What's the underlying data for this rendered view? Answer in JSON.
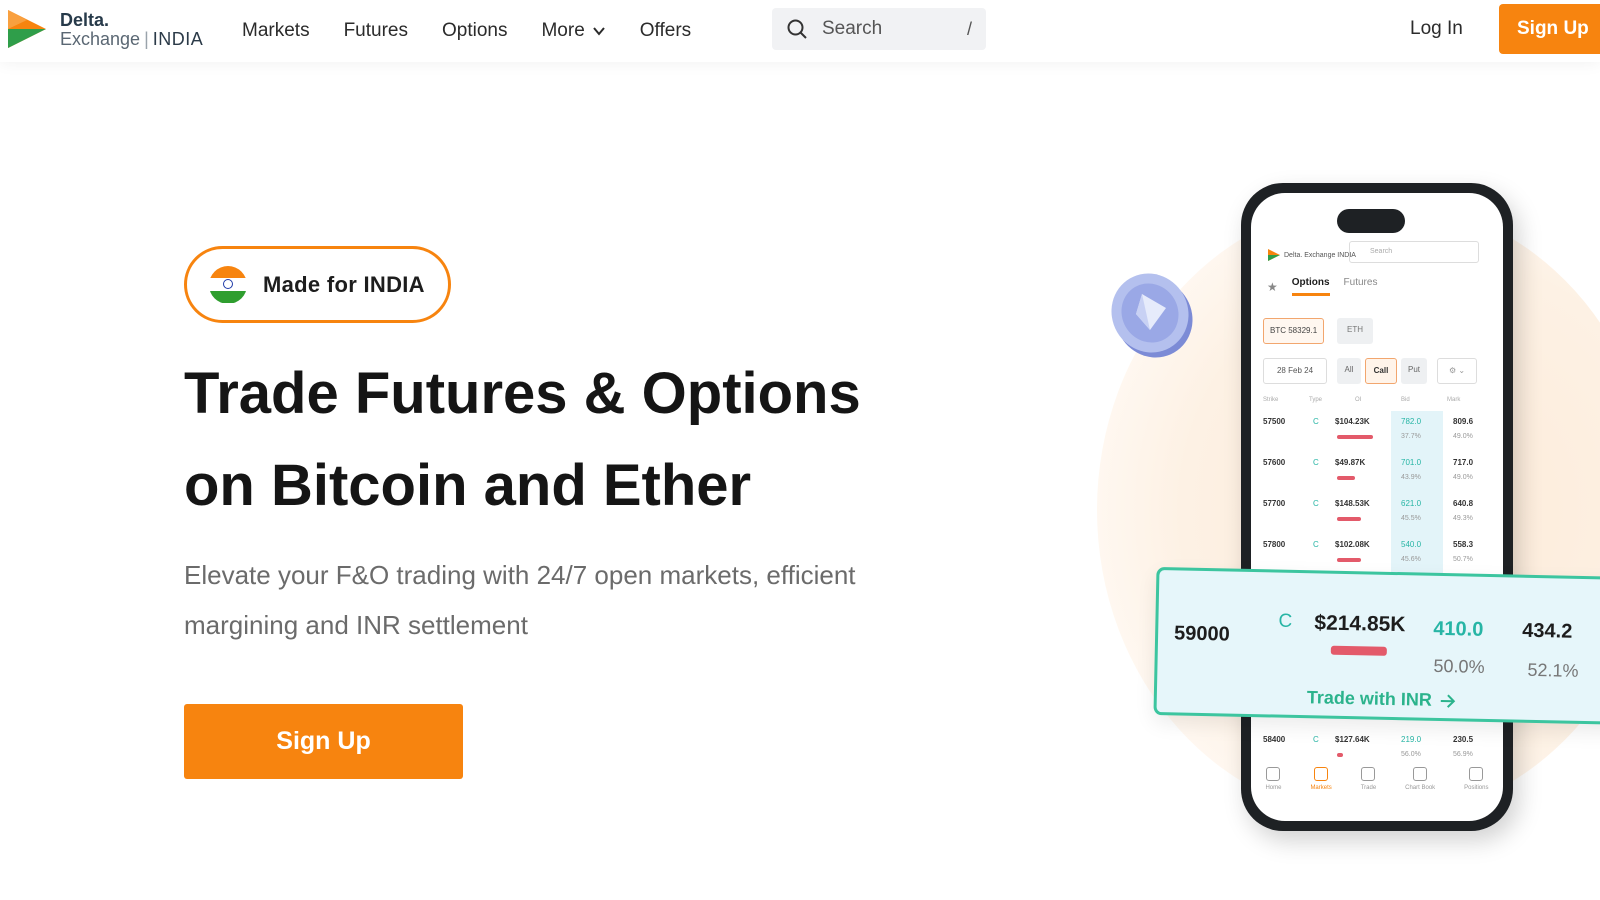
{
  "header": {
    "logo": {
      "name": "Delta.",
      "sub": "Exchange",
      "region": "INDIA"
    },
    "nav": [
      "Markets",
      "Futures",
      "Options",
      "More",
      "Offers"
    ],
    "search": {
      "placeholder": "Search",
      "shortcut": "/"
    },
    "login_label": "Log In",
    "signup_label": "Sign Up"
  },
  "hero": {
    "badge": "Made for INDIA",
    "headline_line1": "Trade Futures & Options",
    "headline_line2": "on Bitcoin and Ether",
    "subtext": "Elevate your F&O trading with 24/7 open markets, efficient margining and INR settlement",
    "cta": "Sign Up"
  },
  "phone": {
    "logo_text": "Delta. Exchange INDIA",
    "search_placeholder": "Search",
    "tabs": [
      "Options",
      "Futures"
    ],
    "chips": [
      "BTC 58329.1",
      "ETH"
    ],
    "filters": [
      "28 Feb 24",
      "All",
      "Call",
      "Put"
    ],
    "columns": [
      "Strike",
      "Type",
      "OI",
      "Bid",
      "Mark"
    ],
    "rows": [
      {
        "strike": "57500",
        "type": "C",
        "oi": "$104.23K",
        "bid": "782.0",
        "mark": "809.6",
        "bid_pct": "37.7%",
        "mark_pct": "49.0%",
        "oi_fill": 0.6
      },
      {
        "strike": "57600",
        "type": "C",
        "oi": "$49.87K",
        "bid": "701.0",
        "mark": "717.0",
        "bid_pct": "43.9%",
        "mark_pct": "49.0%",
        "oi_fill": 0.3
      },
      {
        "strike": "57700",
        "type": "C",
        "oi": "$148.53K",
        "bid": "621.0",
        "mark": "640.8",
        "bid_pct": "45.5%",
        "mark_pct": "49.3%",
        "oi_fill": 0.4
      },
      {
        "strike": "57800",
        "type": "C",
        "oi": "$102.08K",
        "bid": "540.0",
        "mark": "558.3",
        "bid_pct": "45.6%",
        "mark_pct": "50.7%",
        "oi_fill": 0.4
      },
      {
        "strike": "58400",
        "type": "C",
        "oi": "$127.64K",
        "bid": "219.0",
        "mark": "230.5",
        "bid_pct": "56.0%",
        "mark_pct": "56.9%",
        "oi_fill": 0.1
      }
    ],
    "bottom_nav": [
      "Home",
      "Markets",
      "Trade",
      "Chart Book",
      "Positions"
    ]
  },
  "highlight_card": {
    "strike": "59000",
    "type": "C",
    "oi": "$214.85K",
    "bid": "410.0",
    "mark": "434.2",
    "bid_pct": "50.0%",
    "mark_pct": "52.1%",
    "cta": "Trade with INR"
  },
  "colors": {
    "accent": "#f7840f",
    "teal": "#27b5a5",
    "green_border": "#3cc59f",
    "red_bar": "#e35a6a"
  }
}
